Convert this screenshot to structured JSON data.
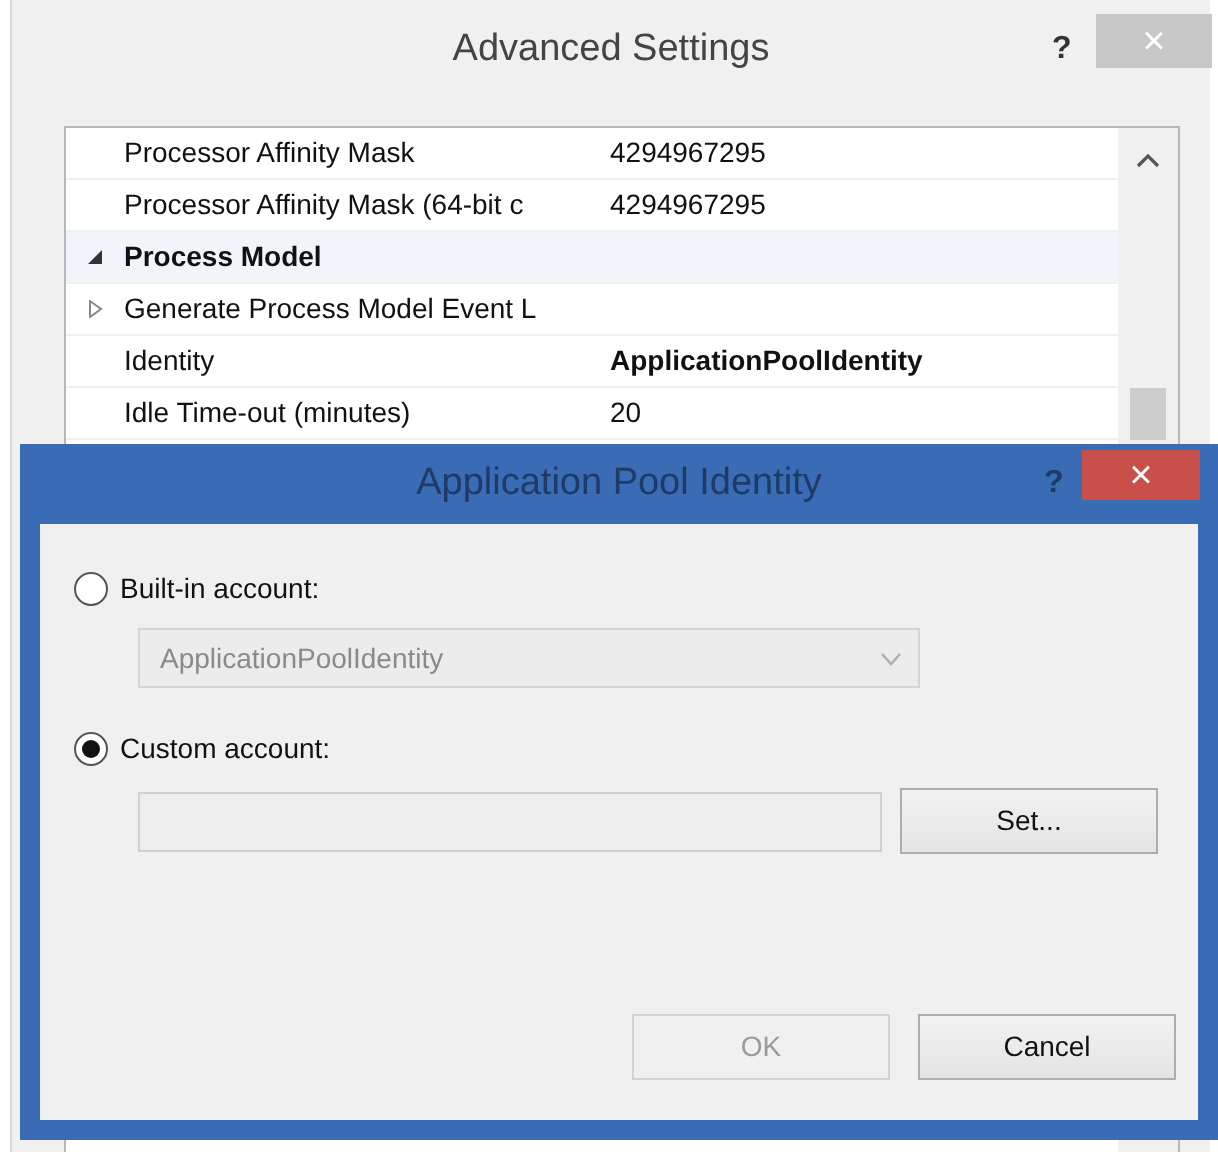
{
  "background_window": {
    "title": "Advanced Settings",
    "help": "?",
    "close": "×",
    "grid_rows": [
      {
        "kind": "property",
        "name": "Processor Affinity Mask",
        "value": "4294967295",
        "modified": false
      },
      {
        "kind": "property",
        "name": "Processor Affinity Mask (64-bit c",
        "value": "4294967295",
        "modified": false
      },
      {
        "kind": "category",
        "name": "Process Model",
        "expanded": true
      },
      {
        "kind": "property",
        "name": "Generate Process Model Event L",
        "expanded": false
      },
      {
        "kind": "property",
        "name": "Identity",
        "value": "ApplicationPoolIdentity",
        "modified": true
      },
      {
        "kind": "property",
        "name": "Idle Time-out (minutes)",
        "value": "20",
        "modified": false
      }
    ]
  },
  "dialog": {
    "title": "Application Pool Identity",
    "help": "?",
    "close": "×",
    "options": [
      {
        "kind": "dropdown",
        "label": "Built-in account:",
        "selected": false,
        "value": "ApplicationPoolIdentity",
        "disabled": true
      },
      {
        "kind": "field",
        "label": "Custom account:",
        "selected": true,
        "button": "Set...",
        "disabled": true
      }
    ],
    "buttons": [
      {
        "label": "OK",
        "disabled": true
      },
      {
        "label": "Cancel",
        "disabled": false
      }
    ]
  }
}
